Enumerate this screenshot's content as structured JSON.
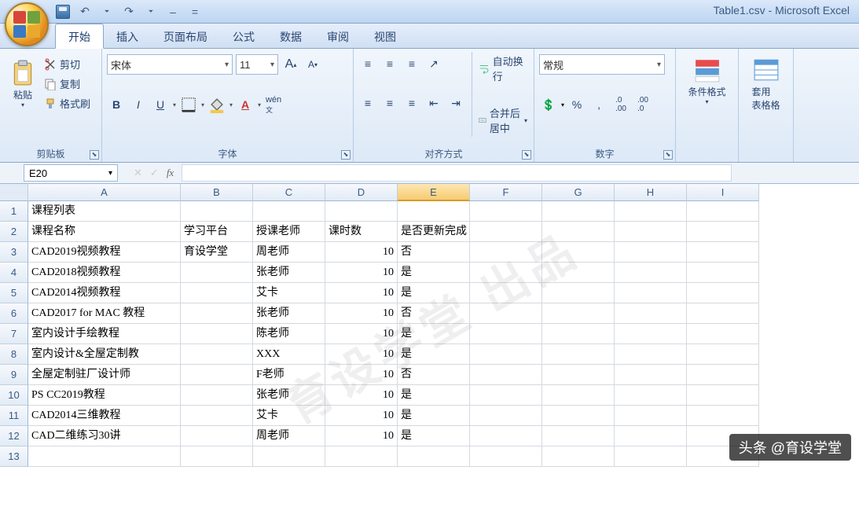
{
  "app": {
    "title": "Table1.csv - Microsoft Excel"
  },
  "qat": {
    "undo": "↶",
    "redo": "↷",
    "more": "⏷",
    "dash": "–",
    "eq": "="
  },
  "tabs": [
    "开始",
    "插入",
    "页面布局",
    "公式",
    "数据",
    "审阅",
    "视图"
  ],
  "ribbon": {
    "clipboard": {
      "label": "剪贴板",
      "paste": "粘贴",
      "cut": "剪切",
      "copy": "复制",
      "format_painter": "格式刷"
    },
    "font": {
      "label": "字体",
      "name": "宋体",
      "size": "11",
      "grow": "A",
      "shrink": "A",
      "bold": "B",
      "italic": "I",
      "underline": "U"
    },
    "alignment": {
      "label": "对齐方式",
      "wrap": "自动换行",
      "merge": "合并后居中"
    },
    "number": {
      "label": "数字",
      "format": "常规",
      "currency": "💲",
      "percent": "%",
      "comma": ",",
      "inc": ".0",
      "dec": ".00"
    },
    "cond": {
      "label": "条件格式"
    },
    "fmt": {
      "label": "套用\n表格格"
    }
  },
  "namebox": "E20",
  "formula": "",
  "columns": [
    "A",
    "B",
    "C",
    "D",
    "E",
    "F",
    "G",
    "H",
    "I"
  ],
  "chart_data": {
    "type": "table",
    "title": "课程列表",
    "headers": [
      "课程名称",
      "学习平台",
      "授课老师",
      "课时数",
      "是否更新完成"
    ],
    "rows": [
      {
        "a": "CAD2019视频教程",
        "b": "育设学堂",
        "c": "周老师",
        "d": 10,
        "e": "否"
      },
      {
        "a": "CAD2018视频教程",
        "b": "",
        "c": "张老师",
        "d": 10,
        "e": "是"
      },
      {
        "a": "CAD2014视频教程",
        "b": "",
        "c": "艾卡",
        "d": 10,
        "e": "是"
      },
      {
        "a": "CAD2017 for MAC 教程",
        "b": "",
        "c": "张老师",
        "d": 10,
        "e": "否"
      },
      {
        "a": "室内设计手绘教程",
        "b": "",
        "c": "陈老师",
        "d": 10,
        "e": "是"
      },
      {
        "a": "室内设计&全屋定制教",
        "b": "",
        "c": "XXX",
        "d": 10,
        "e": "是"
      },
      {
        "a": "全屋定制驻厂设计师",
        "b": "",
        "c": "F老师",
        "d": 10,
        "e": "否"
      },
      {
        "a": "PS CC2019教程",
        "b": "",
        "c": "张老师",
        "d": 10,
        "e": "是"
      },
      {
        "a": "CAD2014三维教程",
        "b": "",
        "c": "艾卡",
        "d": 10,
        "e": "是"
      },
      {
        "a": "CAD二维练习30讲",
        "b": "",
        "c": "周老师",
        "d": 10,
        "e": "是"
      }
    ]
  },
  "watermark": "育设学堂 出品",
  "credit": "头条 @育设学堂"
}
